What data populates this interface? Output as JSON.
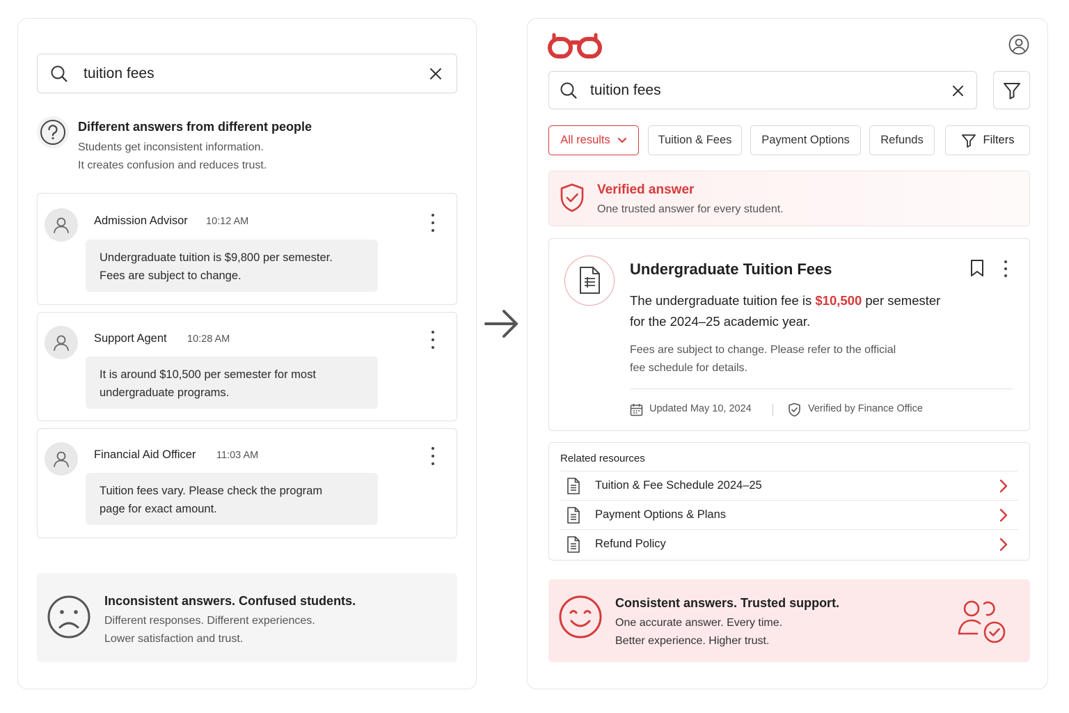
{
  "left": {
    "search": {
      "query": "tuition fees"
    },
    "problem": {
      "title": "Different answers from different people",
      "line1": "Students get inconsistent information.",
      "line2": "It creates confusion and reduces trust."
    },
    "messages": [
      {
        "sender": "Admission Advisor",
        "time": "10:12 AM",
        "line1": "Undergraduate tuition is $9,800 per semester.",
        "line2": "Fees are subject to change."
      },
      {
        "sender": "Support Agent",
        "time": "10:28 AM",
        "line1": "It is around $10,500 per semester for most",
        "line2": "undergraduate programs."
      },
      {
        "sender": "Financial Aid Officer",
        "time": "11:03 AM",
        "line1": "Tuition fees vary. Please check the program",
        "line2": "page for exact amount."
      }
    ],
    "summary": {
      "title": "Inconsistent answers. Confused students.",
      "line1": "Different responses. Different experiences.",
      "line2": "Lower satisfaction and trust."
    }
  },
  "right": {
    "search": {
      "query": "tuition fees"
    },
    "chips": [
      {
        "label": "All results"
      },
      {
        "label": "Tuition & Fees"
      },
      {
        "label": "Payment Options"
      },
      {
        "label": "Refunds"
      },
      {
        "label": "Filters"
      }
    ],
    "verified": {
      "title": "Verified answer",
      "subtitle": "One trusted answer for every student."
    },
    "answer": {
      "title": "Undergraduate Tuition Fees",
      "text_before": "The undergraduate tuition fee is ",
      "amount": "$10,500",
      "text_after": " per semester",
      "text_line2": "for the 2024–25 academic year.",
      "note_line1": "Fees are subject to change. Please refer to the official",
      "note_line2": "fee schedule for details.",
      "updated": "Updated May 10, 2024",
      "verified_by": "Verified by Finance Office"
    },
    "related": {
      "title": "Related resources",
      "items": [
        {
          "label": "Tuition & Fee Schedule 2024–25"
        },
        {
          "label": "Payment Options & Plans"
        },
        {
          "label": "Refund Policy"
        }
      ]
    },
    "summary": {
      "title": "Consistent answers. Trusted support.",
      "line1": "One accurate answer. Every time.",
      "line2": "Better experience. Higher trust."
    }
  },
  "colors": {
    "accent": "#d63a3a",
    "accent_soft": "#fde9ea",
    "muted_text": "#555555",
    "border": "#e2e2e2"
  },
  "icons": [
    "search-icon",
    "close-icon",
    "question-icon",
    "user-icon",
    "more-icon",
    "sad-face-icon",
    "arrow-right-icon",
    "glasses-logo",
    "account-icon",
    "filter-icon",
    "chevron-down-icon",
    "shield-check-icon",
    "document-icon",
    "bookmark-icon",
    "calendar-icon",
    "chevron-right-icon",
    "smile-face-icon",
    "users-check-icon"
  ]
}
